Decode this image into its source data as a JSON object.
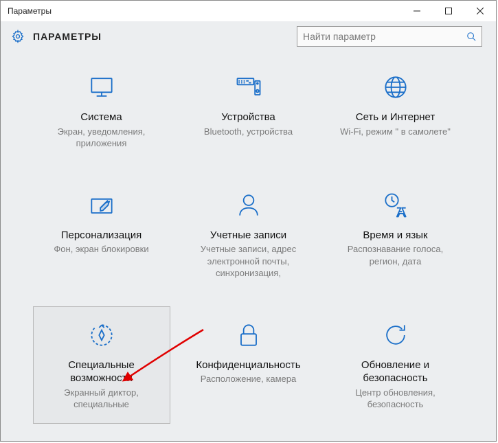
{
  "window": {
    "title": "Параметры"
  },
  "header": {
    "title": "ПАРАМЕТРЫ"
  },
  "search": {
    "placeholder": "Найти параметр"
  },
  "tiles": [
    {
      "title": "Система",
      "desc": "Экран, уведомления, приложения"
    },
    {
      "title": "Устройства",
      "desc": "Bluetooth, устройства"
    },
    {
      "title": "Сеть и Интернет",
      "desc": "Wi-Fi, режим \" в самолете\""
    },
    {
      "title": "Персонализация",
      "desc": "Фон, экран блокировки"
    },
    {
      "title": "Учетные записи",
      "desc": "Учетные записи, адрес электронной почты, синхронизация,"
    },
    {
      "title": "Время и язык",
      "desc": "Распознавание голоса, регион, дата"
    },
    {
      "title": "Специальные возможности",
      "desc": "Экранный диктор, специальные"
    },
    {
      "title": "Конфиденциальность",
      "desc": "Расположение, камера"
    },
    {
      "title": "Обновление и безопасность",
      "desc": "Центр обновления, безопасность"
    }
  ]
}
